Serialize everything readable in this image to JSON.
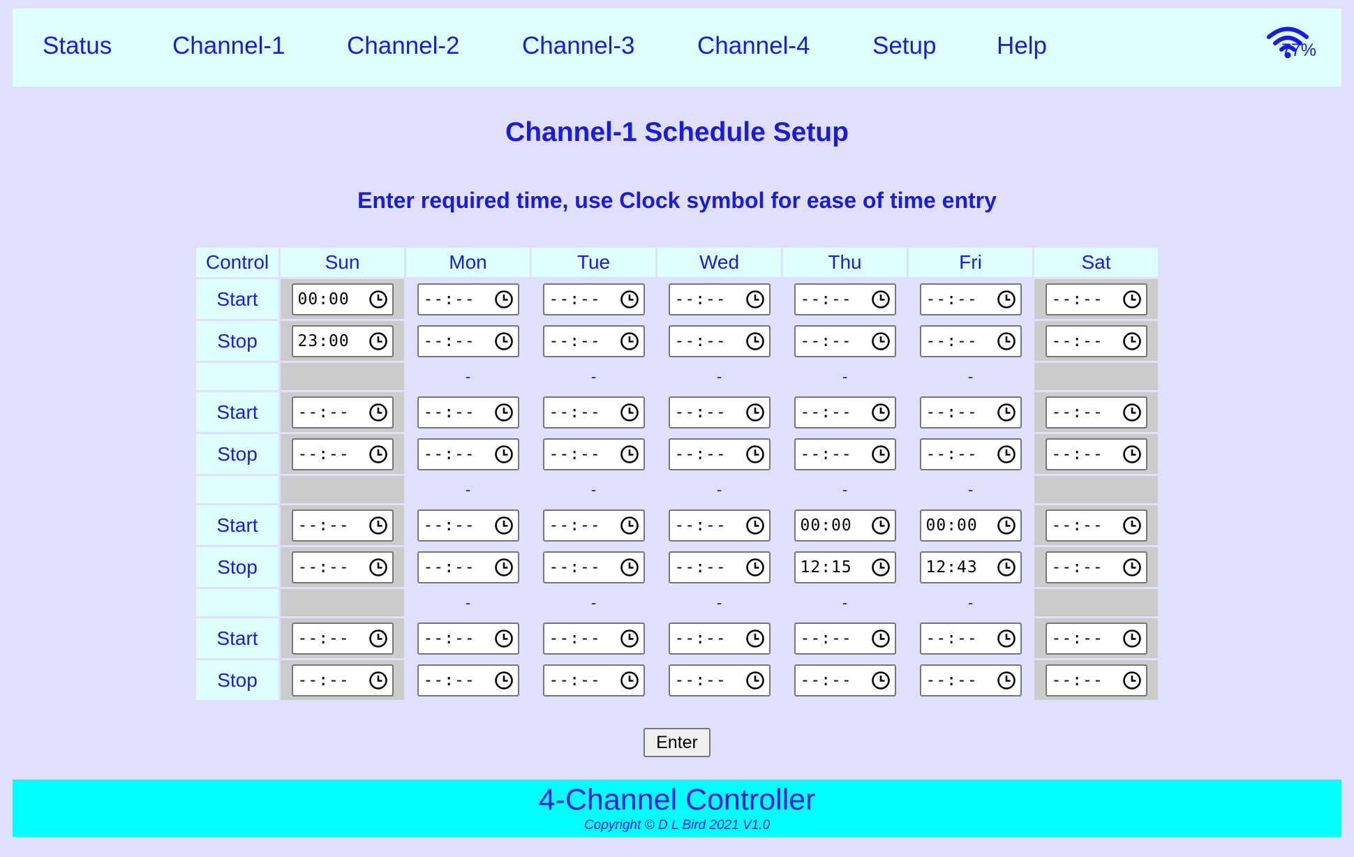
{
  "nav": {
    "items": [
      {
        "label": "Status"
      },
      {
        "label": "Channel-1"
      },
      {
        "label": "Channel-2"
      },
      {
        "label": "Channel-3"
      },
      {
        "label": "Channel-4"
      },
      {
        "label": "Setup"
      },
      {
        "label": "Help"
      }
    ],
    "wifi": {
      "icon": "wifi-icon",
      "signal_pct": "77%"
    }
  },
  "page": {
    "title": "Channel-1 Schedule Setup",
    "instruction": "Enter required time, use Clock symbol for ease of time entry"
  },
  "schedule": {
    "control_header": "Control",
    "days": [
      "Sun",
      "Mon",
      "Tue",
      "Wed",
      "Thu",
      "Fri",
      "Sat"
    ],
    "start_label": "Start",
    "stop_label": "Stop",
    "separator_text": "-",
    "clock_icon": "clock-icon",
    "blocks": [
      {
        "start": [
          "00:00",
          "--:--",
          "--:--",
          "--:--",
          "--:--",
          "--:--",
          "--:--"
        ],
        "stop": [
          "23:00",
          "--:--",
          "--:--",
          "--:--",
          "--:--",
          "--:--",
          "--:--"
        ]
      },
      {
        "start": [
          "--:--",
          "--:--",
          "--:--",
          "--:--",
          "--:--",
          "--:--",
          "--:--"
        ],
        "stop": [
          "--:--",
          "--:--",
          "--:--",
          "--:--",
          "--:--",
          "--:--",
          "--:--"
        ]
      },
      {
        "start": [
          "--:--",
          "--:--",
          "--:--",
          "--:--",
          "00:00",
          "00:00",
          "--:--"
        ],
        "stop": [
          "--:--",
          "--:--",
          "--:--",
          "--:--",
          "12:15",
          "12:43",
          "--:--"
        ]
      },
      {
        "start": [
          "--:--",
          "--:--",
          "--:--",
          "--:--",
          "--:--",
          "--:--",
          "--:--"
        ],
        "stop": [
          "--:--",
          "--:--",
          "--:--",
          "--:--",
          "--:--",
          "--:--",
          "--:--"
        ]
      }
    ]
  },
  "actions": {
    "enter_label": "Enter"
  },
  "footer": {
    "title": "4-Channel Controller",
    "copyright": "Copyright © D L Bird 2021 V1.0"
  },
  "colors": {
    "page_bg": "#e0e0fe",
    "nav_bg": "#e0ffff",
    "footer_bg": "#00ffff",
    "text_blue": "#1a1ae6",
    "weekend_gray": "#cccccc"
  }
}
